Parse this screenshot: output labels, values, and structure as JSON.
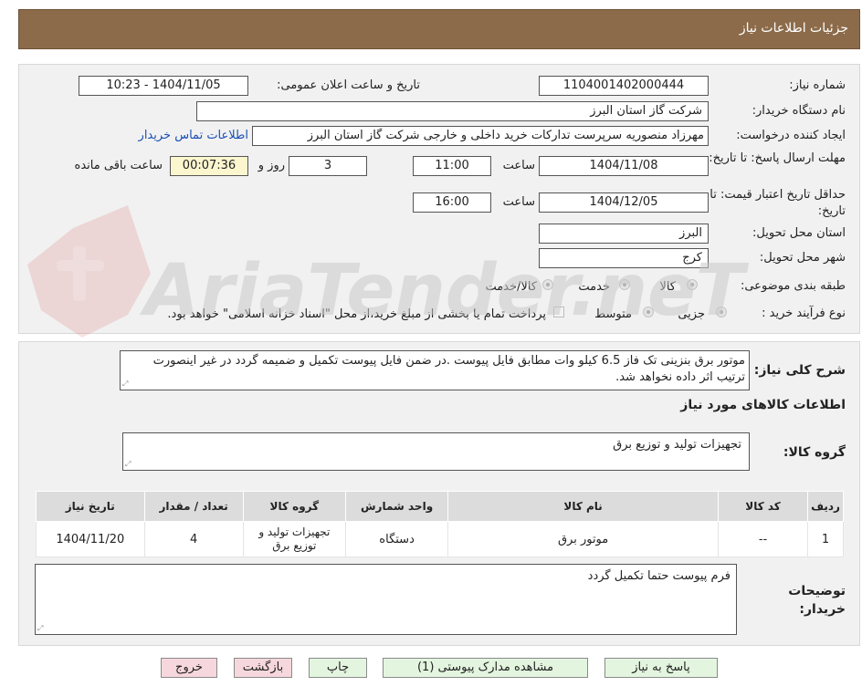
{
  "header": {
    "title": "جزئیات اطلاعات نیاز"
  },
  "form": {
    "need_number": {
      "label": "شماره نیاز:",
      "value": "1104001402000444"
    },
    "announce_datetime": {
      "label": "تاریخ و ساعت اعلان عمومی:",
      "value": "1404/11/05 - 10:23"
    },
    "buyer_org": {
      "label": "نام دستگاه خریدار:",
      "value": "شرکت گاز استان البرز"
    },
    "requester": {
      "label": "ایجاد کننده درخواست:",
      "value": "مهرزاد منصوریه سرپرست تدارکات خرید داخلی و خارجی شرکت گاز استان البرز",
      "contact_link": "اطلاعات تماس خریدار"
    },
    "reply_deadline": {
      "label": "مهلت ارسال پاسخ: تا تاریخ:",
      "date": "1404/11/08",
      "time_label": "ساعت",
      "time": "11:00",
      "days": "3",
      "days_label": "روز و",
      "remaining": "00:07:36",
      "remaining_label": "ساعت باقی مانده"
    },
    "price_validity": {
      "label": "حداقل تاریخ اعتبار قیمت: تا تاریخ:",
      "date": "1404/12/05",
      "time_label": "ساعت",
      "time": "16:00"
    },
    "delivery_province": {
      "label": "استان محل تحویل:",
      "value": "البرز"
    },
    "delivery_city": {
      "label": "شهر محل تحویل:",
      "value": "کرج"
    },
    "category": {
      "label": "طبقه بندی موضوعی:",
      "options": [
        "کالا",
        "خدمت",
        "کالا/خدمت"
      ]
    },
    "purchase_type": {
      "label": "نوع فرآیند خرید :",
      "options": [
        "جزیی",
        "متوسط"
      ],
      "payment_note": "پرداخت تمام یا بخشی از مبلغ خرید،از محل \"اسناد خزانه اسلامی\" خواهد بود."
    }
  },
  "description": {
    "label": "شرح کلی نیاز:",
    "text": "موتور برق بنزینی تک فاز 6.5 کیلو وات مطابق فایل پیوست .در ضمن فایل پیوست تکمیل و ضمیمه گردد در غیر اینصورت ترتیب اثر داده نخواهد شد."
  },
  "goods_info": {
    "title": "اطلاعات کالاهای مورد نیاز",
    "group_label": "گروه کالا:",
    "group_value": "تجهیزات تولید و توزیع برق"
  },
  "table": {
    "headers": [
      "ردیف",
      "کد کالا",
      "نام کالا",
      "واحد شمارش",
      "گروه کالا",
      "تعداد / مقدار",
      "تاریخ نیاز"
    ],
    "rows": [
      [
        "1",
        "--",
        "موتور برق",
        "دستگاه",
        "تجهیزات تولید و توزیع برق",
        "4",
        "1404/11/20"
      ]
    ]
  },
  "buyer_notes": {
    "label": "توضیحات خریدار:",
    "text": "فرم پیوست حتما تکمیل گردد"
  },
  "buttons": {
    "reply": "پاسخ به نیاز",
    "attachments": "مشاهده مدارک پیوستی (1)",
    "print": "چاپ",
    "back": "بازگشت",
    "exit": "خروج"
  },
  "watermark": {
    "text": "AriaTender.neT"
  }
}
